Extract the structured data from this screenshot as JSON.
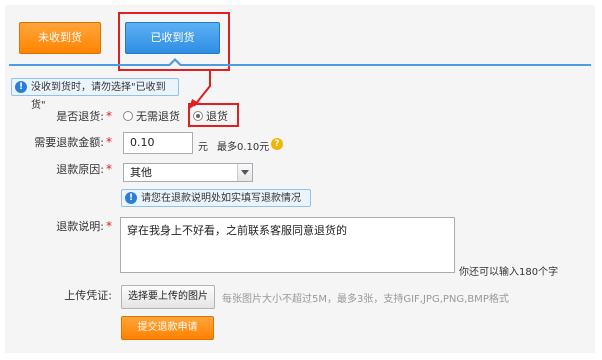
{
  "tabs": {
    "not_received": "未收到货",
    "received": "已收到货"
  },
  "notice": {
    "icon": "info-icon",
    "text": "没收到货时，请勿选择\"已收到货\""
  },
  "form": {
    "return_goods": {
      "label": "是否退货:",
      "required_mark": "*",
      "options": [
        "无需退货",
        "退货"
      ],
      "selected": "退货"
    },
    "refund_amount": {
      "label": "需要退款金额:",
      "required_mark": "*",
      "value": "0.10",
      "unit": "元",
      "max_hint": "最多0.10元",
      "help_icon": "question-icon"
    },
    "refund_reason": {
      "label": "退款原因:",
      "required_mark": "*",
      "selected": "其他",
      "tip": "请您在退款说明处如实填写退款情况"
    },
    "refund_description": {
      "label": "退款说明:",
      "required_mark": "*",
      "value": "穿在我身上不好看，之前联系客服同意退货的",
      "char_hint": "你还可以输入180个字"
    },
    "upload": {
      "label": "上传凭证:",
      "button": "选择要上传的图片",
      "hint": "每张图片大小不超过5M，最多3张，支持GIF,JPG,PNG,BMP格式"
    },
    "submit": "提交退款申请"
  },
  "colors": {
    "accent_orange": "#ff8500",
    "accent_blue": "#2f8de4",
    "highlight_red": "#e02020"
  }
}
